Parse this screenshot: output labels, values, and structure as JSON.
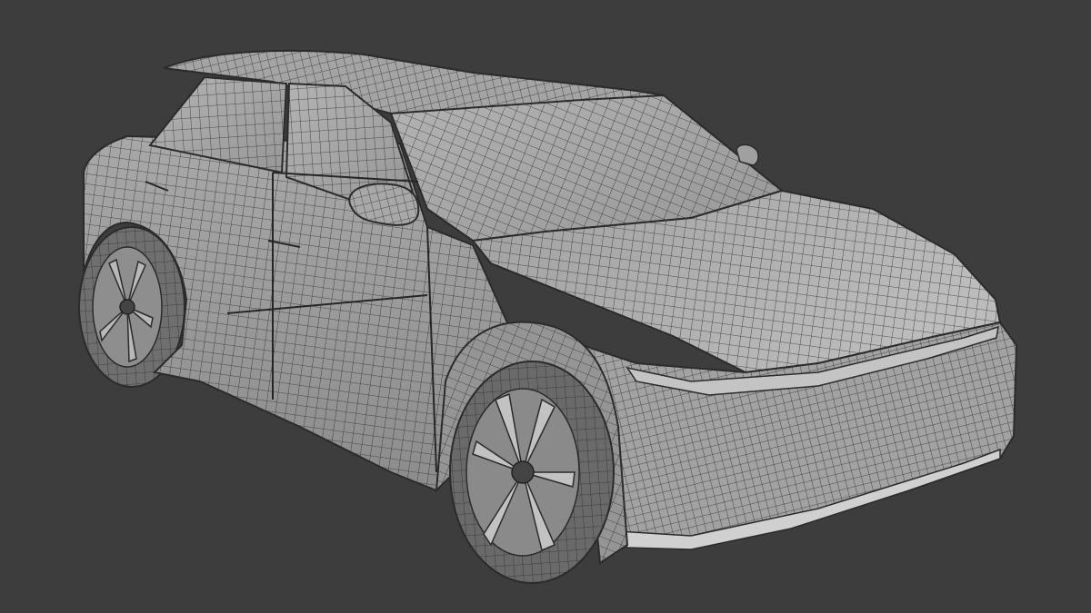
{
  "viewport": {
    "background_color": "#3d3d3d",
    "mesh_fill_color": "#9a9a9a",
    "mesh_line_color": "#2e2e2e",
    "display_mode": "wireframe-on-shaded",
    "subject": "car-model"
  }
}
